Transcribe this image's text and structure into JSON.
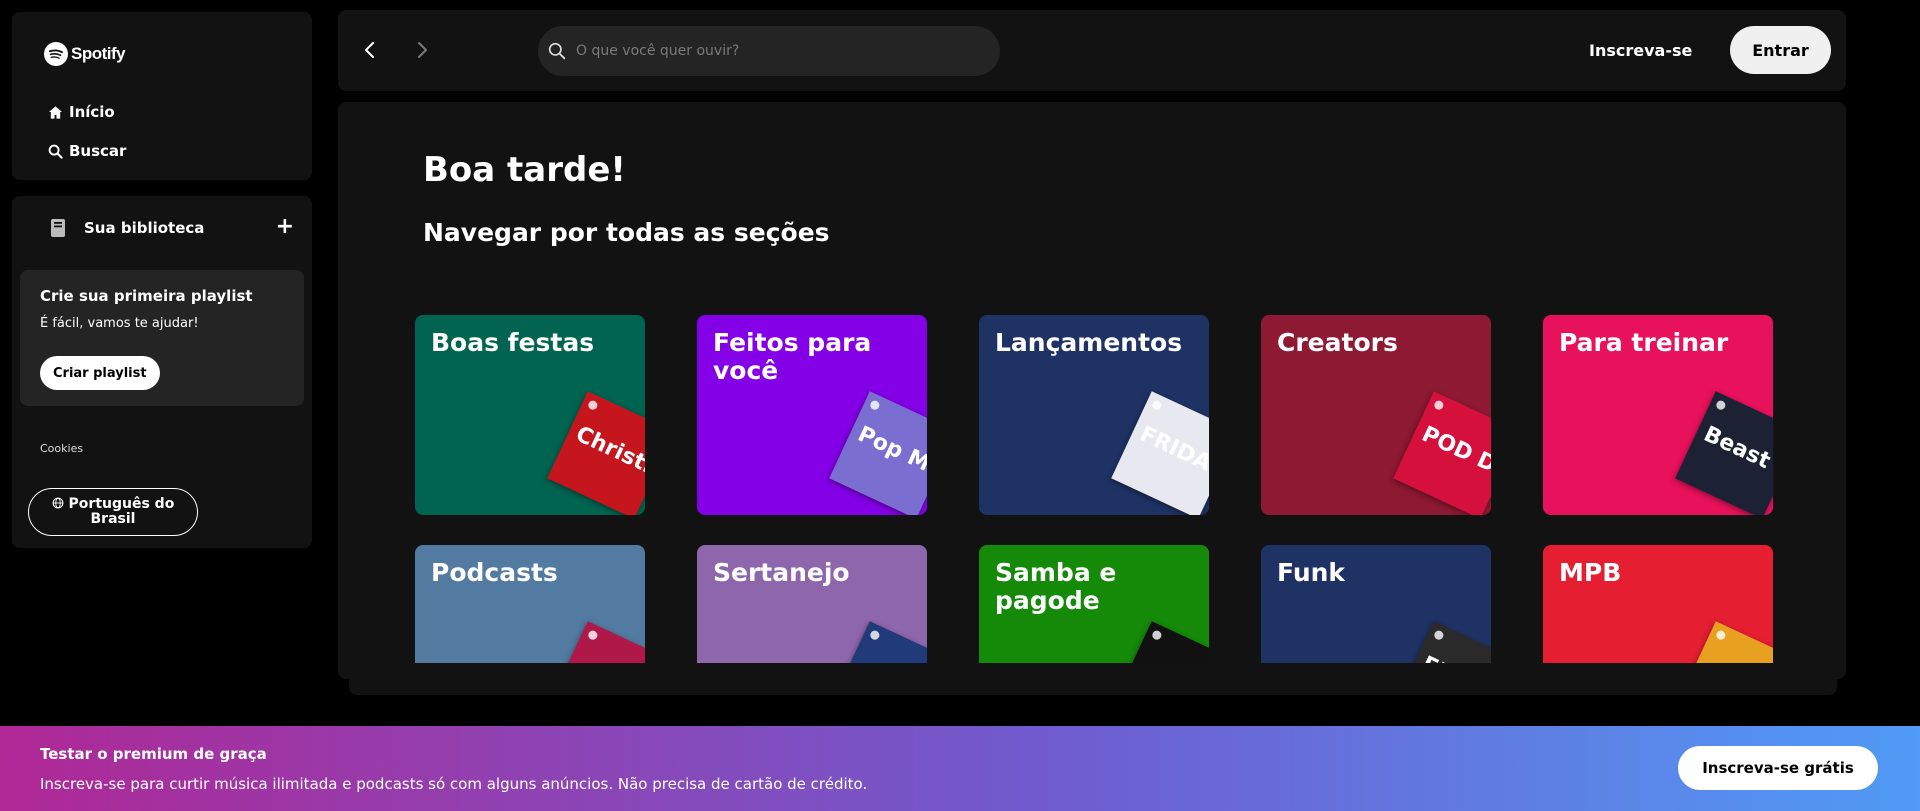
{
  "sidebar": {
    "logo_text": "Spotify",
    "nav": [
      {
        "label": "Início",
        "icon": "home-icon"
      },
      {
        "label": "Buscar",
        "icon": "search-icon"
      }
    ],
    "library": {
      "title": "Sua biblioteca",
      "add_icon": "+",
      "create_card": {
        "title": "Crie sua primeira playlist",
        "subtitle": "É fácil, vamos te ajudar!",
        "button": "Criar playlist"
      },
      "cookies_link": "Cookies",
      "language_button": "Português do Brasil"
    }
  },
  "topbar": {
    "search_placeholder": "O que você quer ouvir?",
    "signup_label": "Inscreva-se",
    "login_label": "Entrar"
  },
  "main": {
    "greeting": "Boa tarde!",
    "section_title": "Navegar por todas as seções",
    "categories": [
      {
        "title": "Boas festas",
        "color": "#006450",
        "art_color": "#c4161c",
        "art_text": "Christmas Hits"
      },
      {
        "title": "Feitos para você",
        "color": "#8400e7",
        "art_color": "#7a6fd0",
        "art_text": "Pop Mix"
      },
      {
        "title": "Lançamentos",
        "color": "#1e3264",
        "art_color": "#e8e8f0",
        "art_text": "FRIDAY"
      },
      {
        "title": "Creators",
        "color": "#8d1932",
        "art_color": "#d6103c",
        "art_text": "POD DELAS"
      },
      {
        "title": "Para treinar",
        "color": "#e8115b",
        "art_color": "#1c2233",
        "art_text": "Beast Mode"
      },
      {
        "title": "Podcasts",
        "color": "#537aa1",
        "art_color": "#b0184a",
        "art_text": ""
      },
      {
        "title": "Sertanejo",
        "color": "#8e66ac",
        "art_color": "#213a7a",
        "art_text": ""
      },
      {
        "title": "Samba e pagode",
        "color": "#148a08",
        "art_color": "#111111",
        "art_text": ""
      },
      {
        "title": "Funk",
        "color": "#1e3264",
        "art_color": "#2a2a2a",
        "art_text": "FUN"
      },
      {
        "title": "MPB",
        "color": "#e61e32",
        "art_color": "#e8a020",
        "art_text": ""
      }
    ]
  },
  "banner": {
    "title": "Testar o premium de graça",
    "subtitle": "Inscreva-se para curtir música ilimitada e podcasts só com alguns anúncios. Não precisa de cartão de crédito.",
    "button": "Inscreva-se grátis"
  }
}
